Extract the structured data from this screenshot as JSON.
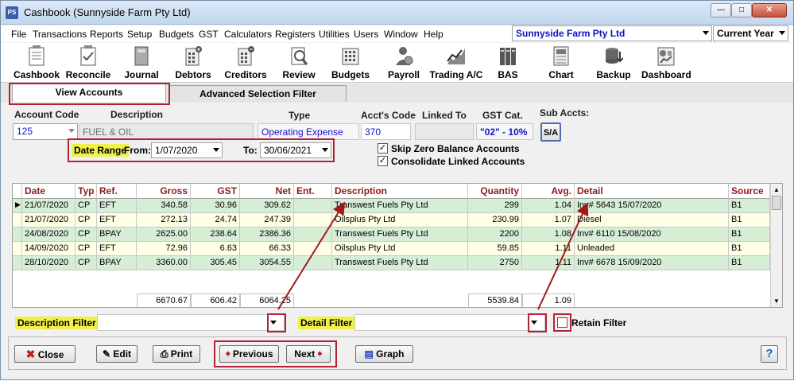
{
  "window": {
    "title": "Cashbook (Sunnyside Farm Pty Ltd)",
    "app_icon": "PS"
  },
  "menu": {
    "items": [
      "File",
      "Transactions",
      "Reports",
      "Setup",
      "Budgets",
      "GST",
      "Calculators",
      "Registers",
      "Utilities",
      "Users",
      "Window",
      "Help"
    ],
    "company": "Sunnyside Farm Pty Ltd",
    "period": "Current Year"
  },
  "toolbar": {
    "items": [
      {
        "label": "Cashbook",
        "icon": "cashbook-icon"
      },
      {
        "label": "Reconcile",
        "icon": "reconcile-icon"
      },
      {
        "label": "Journal",
        "icon": "journal-icon"
      },
      {
        "label": "Debtors",
        "icon": "debtors-icon"
      },
      {
        "label": "Creditors",
        "icon": "creditors-icon"
      },
      {
        "label": "Review",
        "icon": "review-icon"
      },
      {
        "label": "Budgets",
        "icon": "budgets-icon"
      },
      {
        "label": "Payroll",
        "icon": "payroll-icon"
      },
      {
        "label": "Trading A/C",
        "icon": "trading-icon"
      },
      {
        "label": "BAS",
        "icon": "bas-icon"
      },
      {
        "label": "Chart",
        "icon": "chart-icon"
      },
      {
        "label": "Backup",
        "icon": "backup-icon"
      },
      {
        "label": "Dashboard",
        "icon": "dashboard-icon"
      }
    ]
  },
  "tabs": {
    "view_accounts": "View Accounts",
    "advanced_filter": "Advanced Selection Filter"
  },
  "account": {
    "h_code": "Account Code",
    "h_desc": "Description",
    "h_type": "Type",
    "h_accts_code": "Acct's Code",
    "h_linked": "Linked To",
    "h_gst": "GST Cat.",
    "h_sub": "Sub Accts:",
    "code": "125",
    "description": "FUEL & OIL",
    "type": "Operating Expense",
    "accts_code": "370",
    "linked_to": "",
    "gst_cat": "\"02\" - 10%",
    "sub_button": "S/A"
  },
  "date_range": {
    "label": "Date Range",
    "from_label": "From:",
    "from": "1/07/2020",
    "to_label": "To:",
    "to": "30/06/2021"
  },
  "options": {
    "skip_zero": "Skip Zero Balance Accounts",
    "consolidate": "Consolidate Linked Accounts"
  },
  "grid": {
    "headers": [
      "Date",
      "Typ",
      "Ref.",
      "Gross",
      "GST",
      "Net",
      "Ent.",
      "Description",
      "Quantity",
      "Avg.",
      "Detail",
      "Source"
    ],
    "rows": [
      {
        "date": "21/07/2020",
        "typ": "CP",
        "ref": "EFT",
        "gross": "340.58",
        "gst": "30.96",
        "net": "309.62",
        "ent": "",
        "desc": "Transwest Fuels Pty Ltd",
        "qty": "299",
        "avg": "1.04",
        "detail": "Inv# 5643 15/07/2020",
        "source": "B1"
      },
      {
        "date": "21/07/2020",
        "typ": "CP",
        "ref": "EFT",
        "gross": "272.13",
        "gst": "24.74",
        "net": "247.39",
        "ent": "",
        "desc": "Oilsplus Pty Ltd",
        "qty": "230.99",
        "avg": "1.07",
        "detail": "Diesel",
        "source": "B1"
      },
      {
        "date": "24/08/2020",
        "typ": "CP",
        "ref": "BPAY",
        "gross": "2625.00",
        "gst": "238.64",
        "net": "2386.36",
        "ent": "",
        "desc": "Transwest Fuels Pty Ltd",
        "qty": "2200",
        "avg": "1.08",
        "detail": "Inv# 6110 15/08/2020",
        "source": "B1"
      },
      {
        "date": "14/09/2020",
        "typ": "CP",
        "ref": "EFT",
        "gross": "72.96",
        "gst": "6.63",
        "net": "66.33",
        "ent": "",
        "desc": "Oilsplus Pty Ltd",
        "qty": "59.85",
        "avg": "1.11",
        "detail": "Unleaded",
        "source": "B1"
      },
      {
        "date": "28/10/2020",
        "typ": "CP",
        "ref": "BPAY",
        "gross": "3360.00",
        "gst": "305.45",
        "net": "3054.55",
        "ent": "",
        "desc": "Transwest Fuels Pty Ltd",
        "qty": "2750",
        "avg": "1.11",
        "detail": "Inv# 6678 15/09/2020",
        "source": "B1"
      }
    ],
    "totals": {
      "gross": "6670.67",
      "gst": "606.42",
      "net": "6064.25",
      "qty": "5539.84",
      "avg": "1.09"
    }
  },
  "filters": {
    "description_label": "Description Filter",
    "detail_label": "Detail Filter",
    "retain_label": "Retain Filter"
  },
  "buttons": {
    "close": "Close",
    "edit": "Edit",
    "print": "Print",
    "previous": "Previous",
    "next": "Next",
    "graph": "Graph",
    "help": "?"
  },
  "colors": {
    "highlight": "#f0f04a",
    "annotation": "#b22234",
    "row_green": "#d6eed6",
    "row_yellow": "#ffffe6",
    "header_text": "#8b1a1a"
  }
}
